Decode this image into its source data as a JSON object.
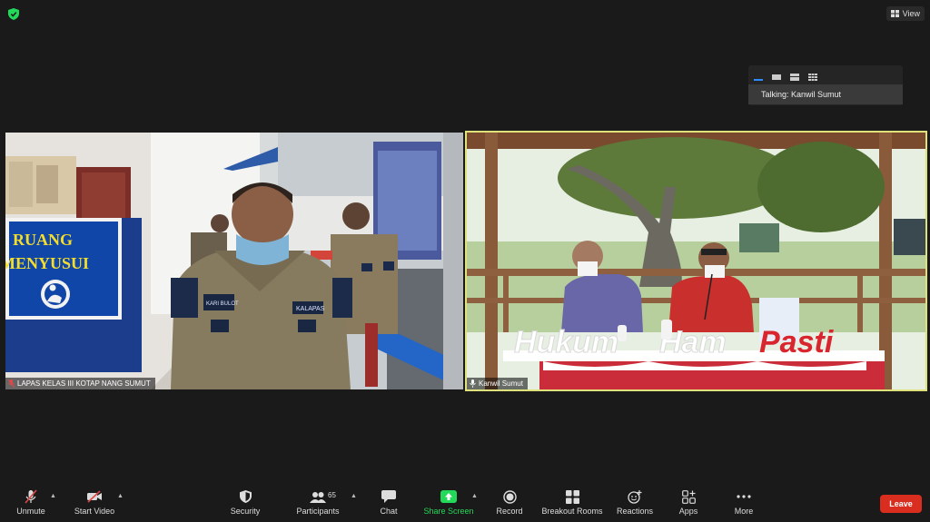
{
  "top_bar": {
    "view_label": "View"
  },
  "layout_popover": {
    "talking": "Talking: Kanwil Sumut"
  },
  "videos": [
    {
      "name": "LAPAS KELAS III KOTAP NANG SUMUT",
      "signs": [
        "RUANG",
        "MENYUSUI"
      ],
      "badges": [
        "KARI BULOT",
        "KALAPAS"
      ]
    },
    {
      "name": "Kanwil Sumut",
      "sign": [
        "Hukum",
        "Ham",
        "Pasti"
      ]
    }
  ],
  "toolbar": {
    "unmute": "Unmute",
    "start_video": "Start Video",
    "security": "Security",
    "participants": "Participants",
    "participants_count": "65",
    "chat": "Chat",
    "share_screen": "Share Screen",
    "record": "Record",
    "breakout_rooms": "Breakout Rooms",
    "reactions": "Reactions",
    "apps": "Apps",
    "more": "More",
    "leave": "Leave"
  },
  "colors": {
    "share_green": "#23d959",
    "leave_red": "#d92d20",
    "active_speaker": "#dfe27a",
    "accent_blue": "#2d8cff"
  }
}
